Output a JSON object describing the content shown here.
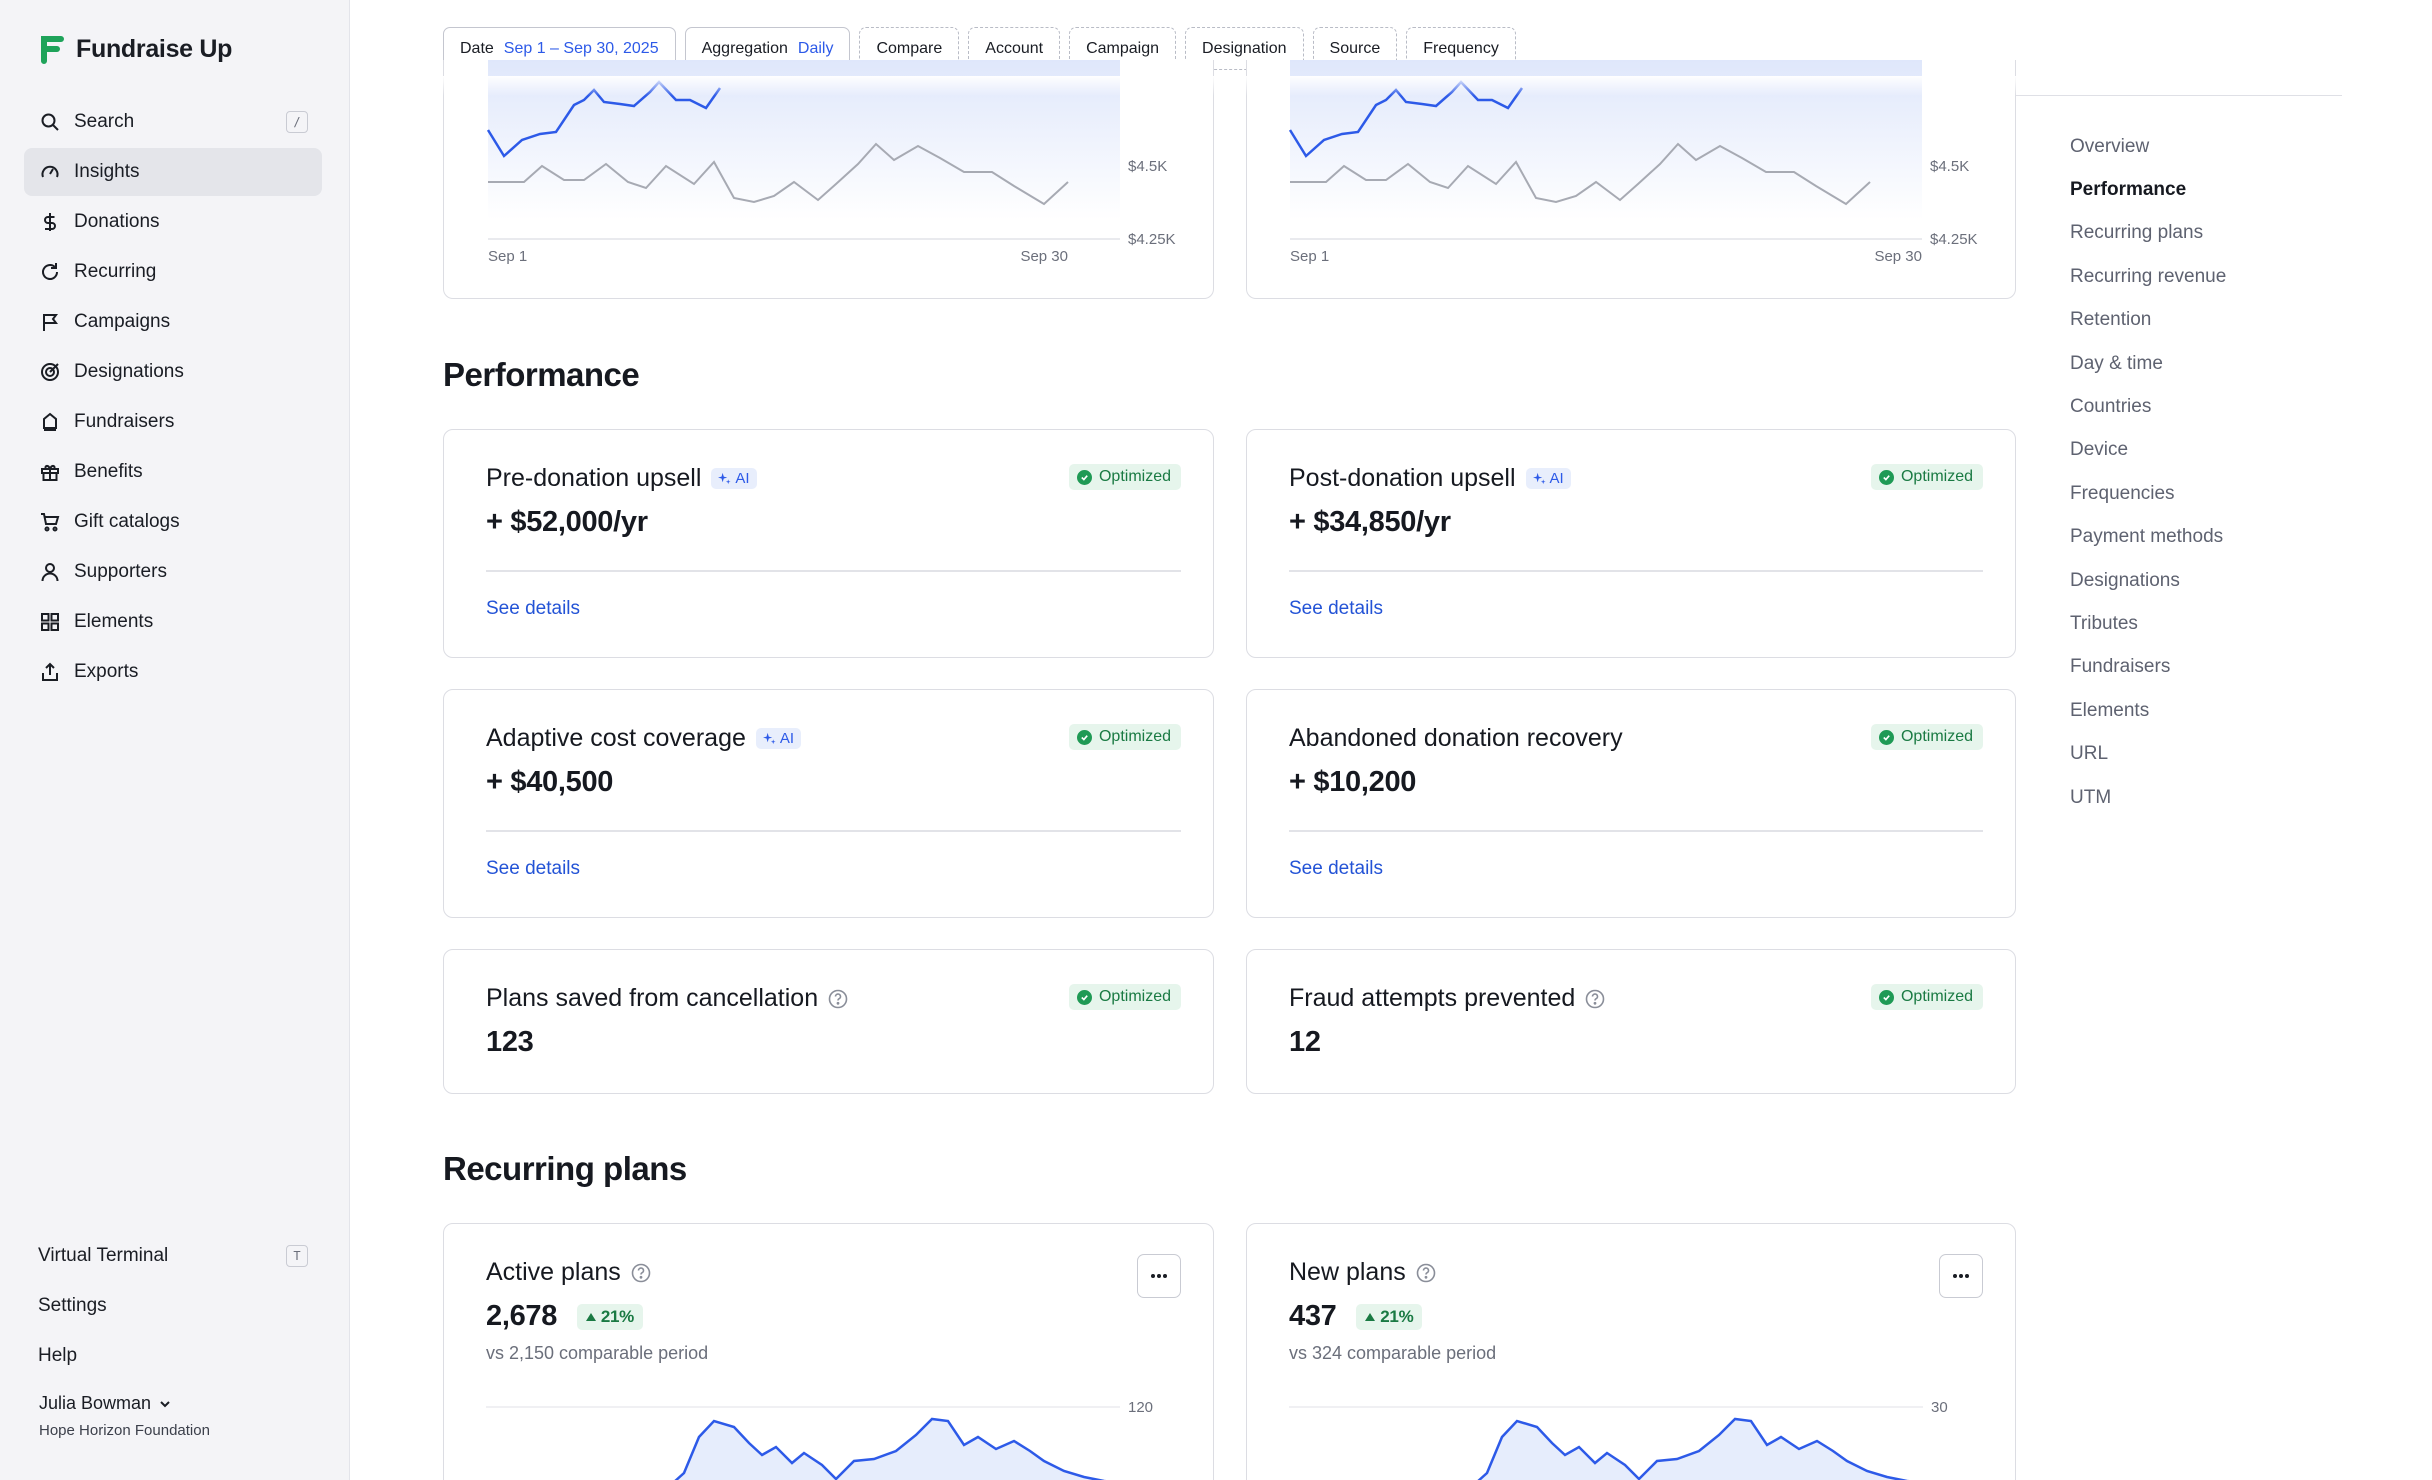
{
  "brand": {
    "name": "Fundraise Up",
    "accent": "#1fa35a"
  },
  "sidebar": {
    "items": [
      {
        "label": "Search",
        "icon": "search-icon",
        "shortcut": "/"
      },
      {
        "label": "Insights",
        "icon": "gauge-icon",
        "active": true
      },
      {
        "label": "Donations",
        "icon": "dollar-icon"
      },
      {
        "label": "Recurring",
        "icon": "refresh-icon"
      },
      {
        "label": "Campaigns",
        "icon": "flag-icon"
      },
      {
        "label": "Designations",
        "icon": "target-icon"
      },
      {
        "label": "Fundraisers",
        "icon": "fundraiser-icon"
      },
      {
        "label": "Benefits",
        "icon": "gift-icon"
      },
      {
        "label": "Gift catalogs",
        "icon": "cart-icon"
      },
      {
        "label": "Supporters",
        "icon": "person-icon"
      },
      {
        "label": "Elements",
        "icon": "grid-icon"
      },
      {
        "label": "Exports",
        "icon": "export-icon"
      }
    ],
    "bottom": [
      {
        "label": "Virtual Terminal",
        "shortcut": "T"
      },
      {
        "label": "Settings"
      },
      {
        "label": "Help"
      }
    ],
    "user": {
      "name": "Julia Bowman",
      "org": "Hope Horizon Foundation"
    }
  },
  "filters": {
    "date_label": "Date",
    "date_value": "Sep 1 – Sep 30, 2025",
    "aggregation_label": "Aggregation",
    "aggregation_value": "Daily",
    "extra": [
      "Compare",
      "Account",
      "Campaign",
      "Designation",
      "Source",
      "Frequency"
    ]
  },
  "top_charts": [
    {
      "x_start": "Sep 1",
      "x_end": "Sep 30",
      "y_ticks": [
        "$4.5K",
        "$4.25K"
      ]
    },
    {
      "x_start": "Sep 1",
      "x_end": "Sep 30",
      "y_ticks": [
        "$4.5K",
        "$4.25K"
      ]
    }
  ],
  "performance": {
    "title": "Performance",
    "cards": [
      {
        "title": "Pre-donation upsell",
        "ai": "AI",
        "badge": "Optimized",
        "value": "+ $52,000/yr",
        "link": "See details"
      },
      {
        "title": "Post-donation upsell",
        "ai": "AI",
        "badge": "Optimized",
        "value": "+ $34,850/yr",
        "link": "See details"
      },
      {
        "title": "Adaptive cost coverage",
        "ai": "AI",
        "badge": "Optimized",
        "value": "+ $40,500",
        "link": "See details"
      },
      {
        "title": "Abandoned donation recovery",
        "badge": "Optimized",
        "value": "+ $10,200",
        "link": "See details"
      },
      {
        "title": "Plans saved from cancellation",
        "badge": "Optimized",
        "value": "123"
      },
      {
        "title": "Fraud attempts prevented",
        "badge": "Optimized",
        "value": "12"
      }
    ]
  },
  "recurring_plans": {
    "title": "Recurring plans",
    "cards": [
      {
        "title": "Active plans",
        "value": "2,678",
        "trend": "21%",
        "sub": "vs 2,150 comparable period",
        "y_tick": "120"
      },
      {
        "title": "New plans",
        "value": "437",
        "trend": "21%",
        "sub": "vs 324 comparable period",
        "y_tick": "30"
      }
    ]
  },
  "toc": [
    "Overview",
    "Performance",
    "Recurring plans",
    "Recurring revenue",
    "Retention",
    "Day & time",
    "Countries",
    "Device",
    "Frequencies",
    "Payment methods",
    "Designations",
    "Tributes",
    "Fundraisers",
    "Elements",
    "URL",
    "UTM"
  ],
  "toc_active": "Performance",
  "colors": {
    "link": "#2353d6",
    "series_primary": "#2d5ae8",
    "series_compare": "#a7aab3",
    "optimized": "#1f9a55"
  }
}
